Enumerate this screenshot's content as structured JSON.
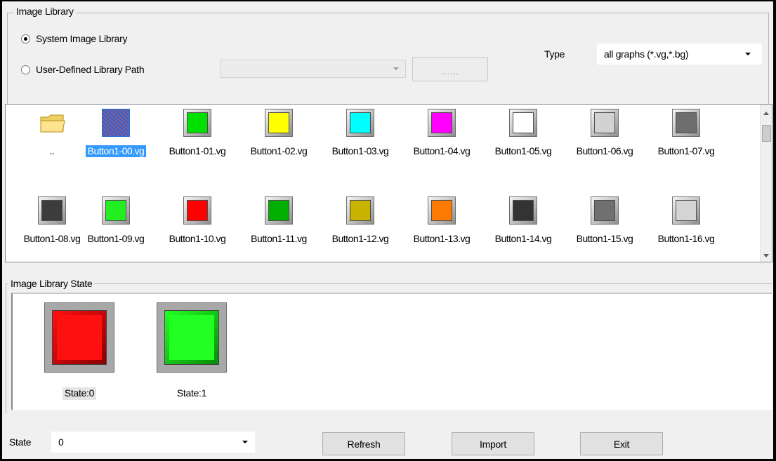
{
  "image_library": {
    "title": "Image Library",
    "system_option": "System Image Library",
    "user_option": "User-Defined Library Path",
    "selected_option": "system",
    "path_value": "",
    "browse_label": "......",
    "type_label": "Type",
    "type_value": "all graphs (*.vg,*.bg)"
  },
  "file_list": {
    "parent_folder_label": "..",
    "selected_file": "Button1-00.vg",
    "items": [
      {
        "name": "Button1-00.vg",
        "color": "#7a4fa0"
      },
      {
        "name": "Button1-01.vg",
        "color": "#00e000"
      },
      {
        "name": "Button1-02.vg",
        "color": "#ffff00"
      },
      {
        "name": "Button1-03.vg",
        "color": "#00ffff"
      },
      {
        "name": "Button1-04.vg",
        "color": "#ff00ff"
      },
      {
        "name": "Button1-05.vg",
        "color": "#ffffff"
      },
      {
        "name": "Button1-06.vg",
        "color": "#d2d2d2"
      },
      {
        "name": "Button1-07.vg",
        "color": "#6e6e6e"
      },
      {
        "name": "Button1-08.vg",
        "color": "#3c3c3c"
      },
      {
        "name": "Button1-09.vg",
        "color": "#22ee22"
      },
      {
        "name": "Button1-10.vg",
        "color": "#ff0000"
      },
      {
        "name": "Button1-11.vg",
        "color": "#00b000"
      },
      {
        "name": "Button1-12.vg",
        "color": "#c8b400"
      },
      {
        "name": "Button1-13.vg",
        "color": "#ff7a00"
      },
      {
        "name": "Button1-14.vg",
        "color": "#333333"
      },
      {
        "name": "Button1-15.vg",
        "color": "#707070"
      },
      {
        "name": "Button1-16.vg",
        "color": "#d4d4d4"
      }
    ]
  },
  "state_group": {
    "title": "Image Library State",
    "states": [
      {
        "label": "State:0",
        "color": "#ff1010",
        "shadow": "#8a0000"
      },
      {
        "label": "State:1",
        "color": "#22ff22",
        "shadow": "#0a8a0a"
      }
    ]
  },
  "bottom": {
    "state_label": "State",
    "state_value": "0",
    "refresh_label": "Refresh",
    "import_label": "Import",
    "exit_label": "Exit"
  }
}
